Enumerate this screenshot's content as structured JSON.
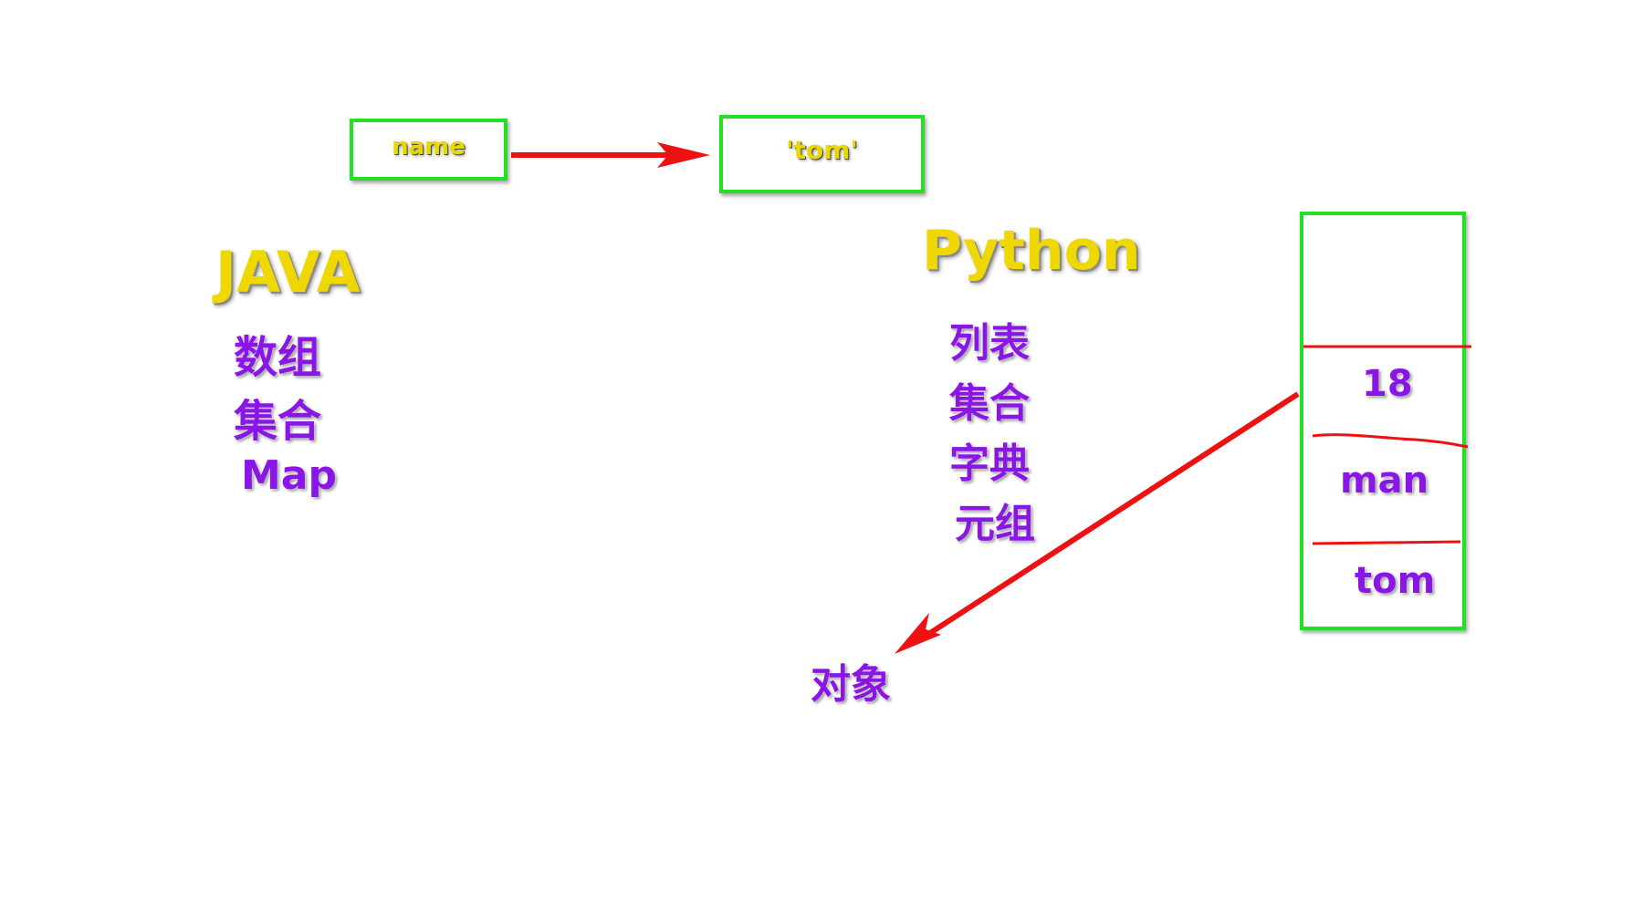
{
  "top_boxes": {
    "name": "name",
    "value": "'tom'"
  },
  "java": {
    "title": "JAVA",
    "items": [
      "数组",
      "集合",
      "Map"
    ]
  },
  "python": {
    "title": "Python",
    "items": [
      "列表",
      "集合",
      "字典",
      "元组"
    ]
  },
  "stack": {
    "cells": [
      "",
      "18",
      "man",
      "tom"
    ]
  },
  "object_label": "对象",
  "colors": {
    "box_border": "#22e022",
    "arrow": "#ee1111",
    "title": "#efd800",
    "label": "#8a16e6"
  }
}
